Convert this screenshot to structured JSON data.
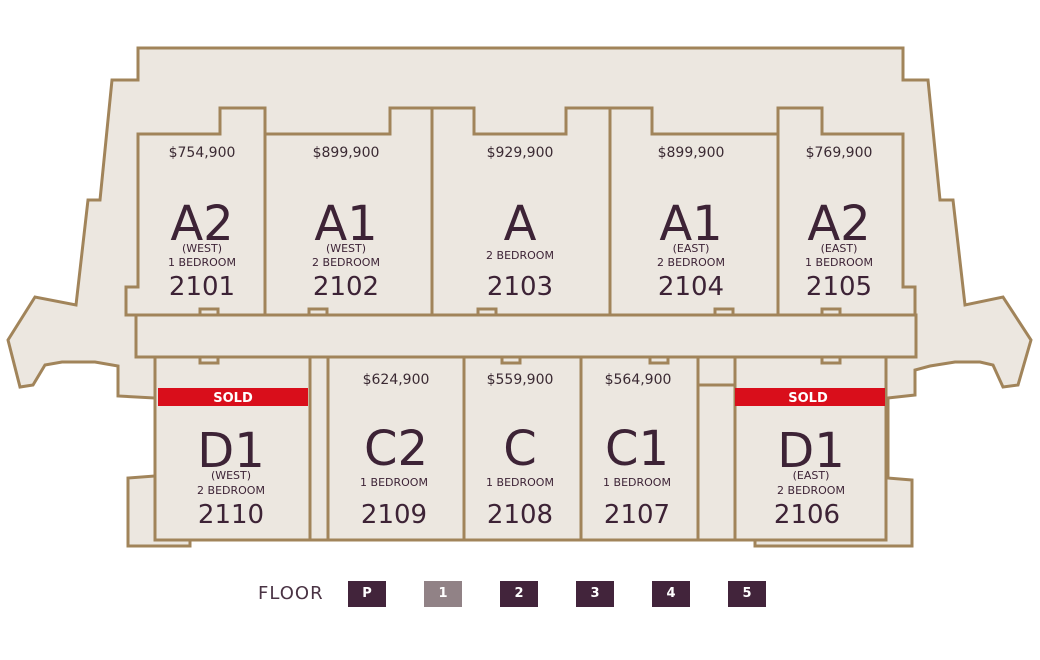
{
  "colors": {
    "fill": "#ece7e0",
    "stroke": "#a1845a",
    "text": "#3d2336",
    "sold": "#d90e1b",
    "floor_button": "#42243b",
    "floor_active": "#918286"
  },
  "units": {
    "u2101": {
      "price": "$754,900",
      "type": "A2",
      "side": "(WEST)",
      "beds": "1 BEDROOM",
      "number": "2101"
    },
    "u2102": {
      "price": "$899,900",
      "type": "A1",
      "side": "(WEST)",
      "beds": "2 BEDROOM",
      "number": "2102"
    },
    "u2103": {
      "price": "$929,900",
      "type": "A",
      "beds": "2 BEDROOM",
      "number": "2103"
    },
    "u2104": {
      "price": "$899,900",
      "type": "A1",
      "side": "(EAST)",
      "beds": "2 BEDROOM",
      "number": "2104"
    },
    "u2105": {
      "price": "$769,900",
      "type": "A2",
      "side": "(EAST)",
      "beds": "1 BEDROOM",
      "number": "2105"
    },
    "u2110": {
      "status": "SOLD",
      "type": "D1",
      "side": "(WEST)",
      "beds": "2 BEDROOM",
      "number": "2110"
    },
    "u2109": {
      "price": "$624,900",
      "type": "C2",
      "beds": "1 BEDROOM",
      "number": "2109"
    },
    "u2108": {
      "price": "$559,900",
      "type": "C",
      "beds": "1 BEDROOM",
      "number": "2108"
    },
    "u2107": {
      "price": "$564,900",
      "type": "C1",
      "beds": "1 BEDROOM",
      "number": "2107"
    },
    "u2106": {
      "status": "SOLD",
      "type": "D1",
      "side": "(EAST)",
      "beds": "2 BEDROOM",
      "number": "2106"
    }
  },
  "floor_nav": {
    "label": "FLOOR",
    "buttons": [
      {
        "label": "P",
        "active": false
      },
      {
        "label": "1",
        "active": true
      },
      {
        "label": "2",
        "active": false
      },
      {
        "label": "3",
        "active": false
      },
      {
        "label": "4",
        "active": false
      },
      {
        "label": "5",
        "active": false
      }
    ]
  }
}
